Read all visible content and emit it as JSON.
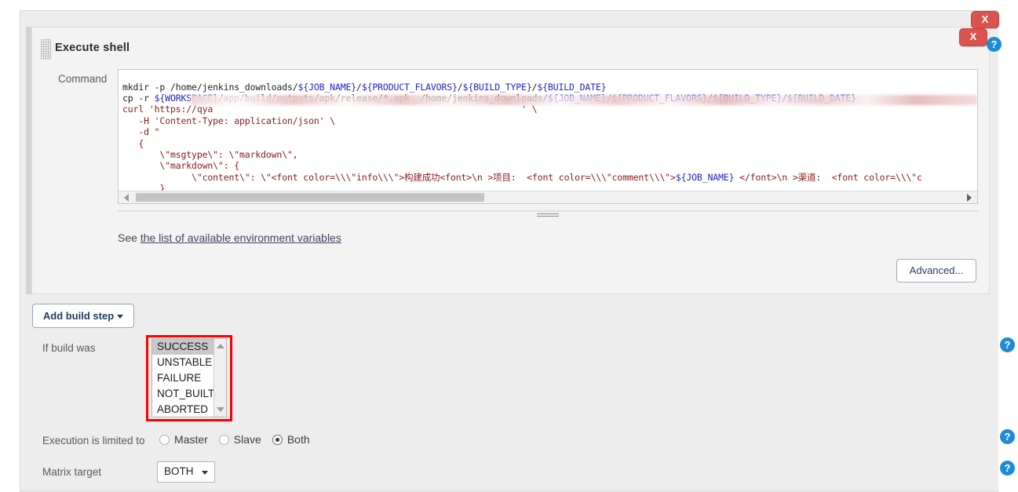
{
  "window": {
    "title": "Execute shell"
  },
  "build_step": {
    "title": "Execute shell",
    "grip_icon": "drag-grip-icon",
    "delete_label": "X",
    "help_label": "?"
  },
  "command": {
    "label": "Command",
    "lines": [
      "mkdir -p /home/jenkins_downloads/${JOB_NAME}/${PRODUCT_FLAVORS}/${BUILD_TYPE}/${BUILD_DATE}",
      "cp -r ${WORKSPACE}/app/build/outputs/apk/release/*.apk  /home/jenkins_downloads/${JOB_NAME}/${PRODUCT_FLAVORS}/${BUILD_TYPE}/${BUILD_DATE}",
      "curl 'https://qya                                                          ' \\",
      "   -H 'Content-Type: application/json' \\",
      "   -d \"",
      "   {",
      "       \\\"msgtype\\\": \\\"markdown\\\",",
      "       \\\"markdown\\\": {",
      "             \\\"content\\\": \\\"<font color=\\\\\\\"info\\\\\\\">构建成功<font>\\n >项目:  <font color=\\\\\\\"comment\\\\\\\">${JOB_NAME} </font>\\n >渠道:  <font color=\\\\\\\"c",
      "       }",
      "   }\""
    ],
    "redacted_url_note": "blurred-redaction"
  },
  "env_help": {
    "prefix": "See ",
    "link_text": "the list of available environment variables"
  },
  "buttons": {
    "advanced": "Advanced...",
    "add_build_step": "Add build step"
  },
  "if_build_was": {
    "label": "If build was",
    "options": [
      "SUCCESS",
      "UNSTABLE",
      "FAILURE",
      "NOT_BUILT",
      "ABORTED"
    ],
    "selected": "SUCCESS",
    "highlight_color": "#ff0000"
  },
  "execution": {
    "label": "Execution is limited to",
    "options": [
      "Master",
      "Slave",
      "Both"
    ],
    "selected": "Both"
  },
  "matrix_target": {
    "label": "Matrix target",
    "value": "BOTH",
    "options": [
      "BOTH"
    ]
  },
  "colors": {
    "panel_bg": "#ededed",
    "inner_bg": "#f3f3f3",
    "danger": "#d9534f",
    "help_blue": "#1f8bd6",
    "code_red": "#8b1a1a",
    "code_blue": "#2222cc"
  }
}
